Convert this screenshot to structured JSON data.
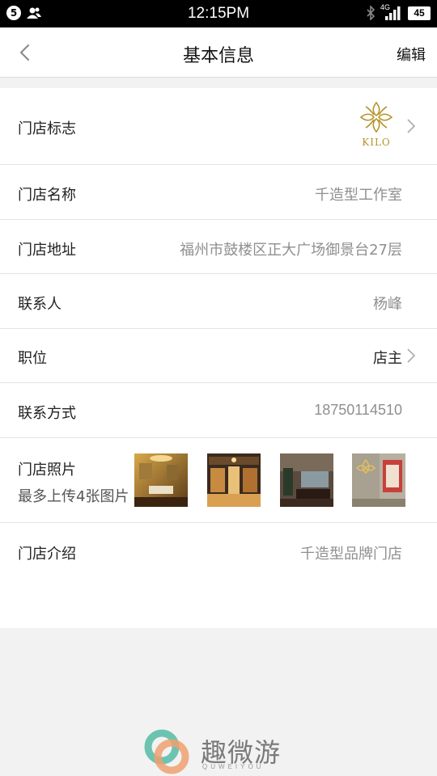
{
  "status_bar": {
    "sim_number": "5",
    "time": "12:15PM",
    "network": "4G",
    "battery": "45"
  },
  "nav": {
    "title": "基本信息",
    "edit_label": "编辑"
  },
  "rows": {
    "logo": {
      "label": "门店标志",
      "logo_text": "KILO"
    },
    "name": {
      "label": "门店名称",
      "value": "千造型工作室"
    },
    "address": {
      "label": "门店地址",
      "value": "福州市鼓楼区正大广场御景台27层"
    },
    "contact": {
      "label": "联系人",
      "value": "杨峰"
    },
    "position": {
      "label": "职位",
      "value": "店主"
    },
    "phone": {
      "label": "联系方式",
      "value": "18750114510"
    },
    "photos": {
      "label": "门店照片",
      "hint": "最多上传4张图片"
    },
    "intro": {
      "label": "门店介绍",
      "value": "千造型品牌门店"
    }
  },
  "watermark": {
    "brand": "趣微游",
    "sub": "QUWEIYOU"
  },
  "colors": {
    "accent_gold": "#b5952b",
    "value_gray": "#8f8f8f",
    "background": "#f2f2f2"
  }
}
